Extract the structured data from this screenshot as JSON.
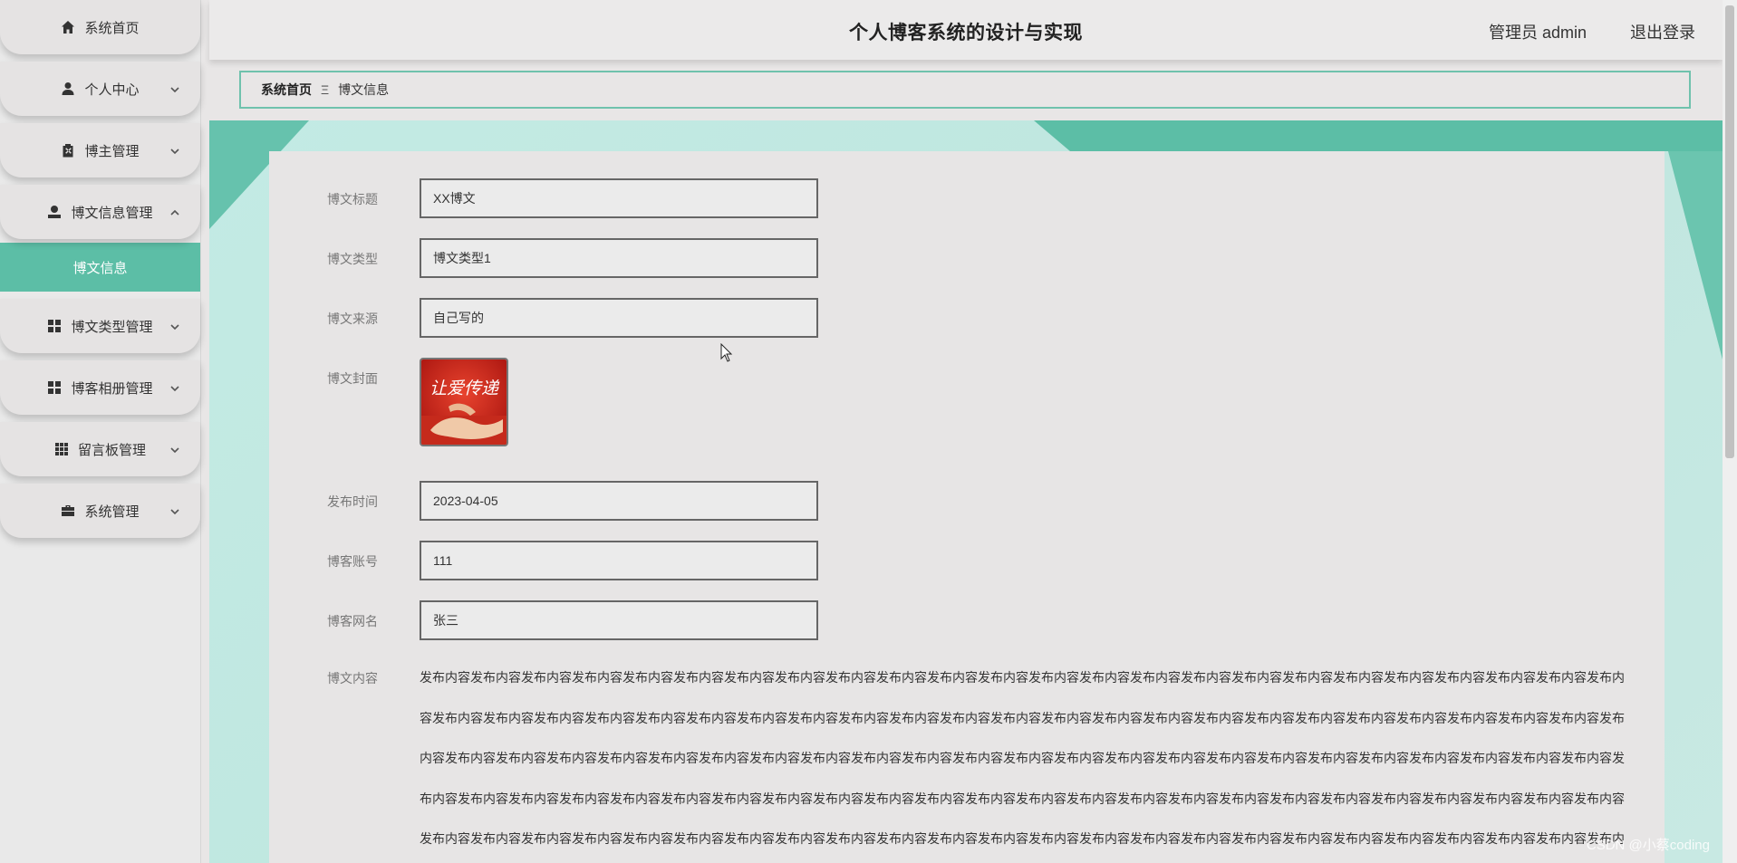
{
  "header": {
    "title": "个人博客系统的设计与实现",
    "user": "管理员 admin",
    "logout": "退出登录"
  },
  "sidebar": {
    "items": [
      {
        "label": "系统首页",
        "icon": "home-icon"
      },
      {
        "label": "个人中心",
        "icon": "user-icon"
      },
      {
        "label": "博主管理",
        "icon": "clipboard-icon"
      },
      {
        "label": "博文信息管理",
        "icon": "person-icon",
        "expanded": true
      },
      {
        "label": "博文类型管理",
        "icon": "grid-icon"
      },
      {
        "label": "博客相册管理",
        "icon": "grid-icon"
      },
      {
        "label": "留言板管理",
        "icon": "apps-icon"
      },
      {
        "label": "系统管理",
        "icon": "briefcase-icon"
      }
    ],
    "active_sub": "博文信息"
  },
  "breadcrumb": {
    "home": "系统首页",
    "separator": "Ξ",
    "current": "博文信息"
  },
  "form": {
    "title_label": "博文标题",
    "title_value": "XX博文",
    "type_label": "博文类型",
    "type_value": "博文类型1",
    "source_label": "博文来源",
    "source_value": "自己写的",
    "cover_label": "博文封面",
    "cover_text": "让爱传递",
    "time_label": "发布时间",
    "time_value": "2023-04-05",
    "account_label": "博客账号",
    "account_value": "111",
    "nickname_label": "博客网名",
    "nickname_value": "张三",
    "content_label": "博文内容",
    "content_value": "发布内容发布内容发布内容发布内容发布内容发布内容发布内容发布内容发布内容发布内容发布内容发布内容发布内容发布内容发布内容发布内容发布内容发布内容发布内容发布内容发布内容发布内容发布内容发布内容发布内容发布内容发布内容发布内容发布内容发布内容发布内容发布内容发布内容发布内容发布内容发布内容发布内容发布内容发布内容发布内容发布内容发布内容发布内容发布内容发布内容发布内容发布内容发布内容发布内容发布内容发布内容发布内容发布内容发布内容发布内容发布内容发布内容发布内容发布内容发布内容发布内容发布内容发布内容发布内容发布内容发布内容发布内容发布内容发布内容发布内容发布内容发布内容发布内容发布内容发布内容发布内容发布内容发布内容发布内容发布内容发布内容发布内容发布内容发布内容发布内容发布内容发布内容发布内容发布内容发布内容发布内容发布内容发布内容发布内容发布内容发布内容发布内容发布内容发布内容发布内容发布内容发布内容发布内容发布内容发布内容发布内容发布内容发布内容发布内容发布内容发布内容发布内容发布内容发布内容发布内容发布内容发布内容发布内容发布内容发布内容发布内容发布内容发布内容发布内容"
  },
  "watermark": "CSDN @小蔡coding",
  "colors": {
    "accent": "#5cbea6",
    "breadcrumb_border": "#6fc2ad"
  }
}
